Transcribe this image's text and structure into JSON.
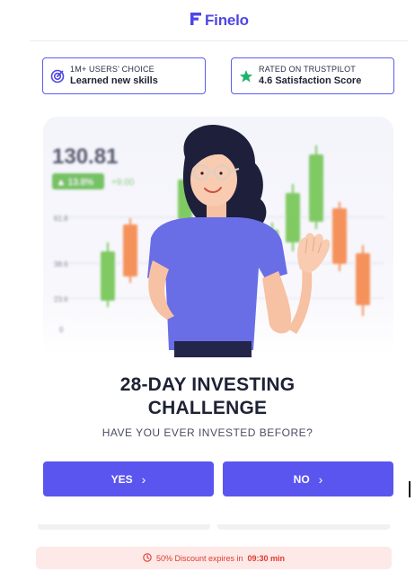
{
  "brand": {
    "name": "Finelo",
    "color": "#4f46e5"
  },
  "badges": [
    {
      "icon": "target-icon",
      "small": "1M+ USERS' CHOICE",
      "big": "Learned new skills"
    },
    {
      "icon": "star-icon",
      "small": "RATED ON TRUSTPILOT",
      "big": "4.6 Satisfaction Score"
    }
  ],
  "hero": {
    "price": "130.81",
    "change_badge": "▲ 13.8%",
    "change_abs": "+9.00",
    "axis_ticks": [
      "61.8",
      "38.6",
      "23.6",
      "0"
    ]
  },
  "question": {
    "title_line1": "28-DAY INVESTING",
    "title_line2": "CHALLENGE",
    "subtitle": "HAVE YOU EVER INVESTED BEFORE?"
  },
  "answers": [
    {
      "label": "YES",
      "icon": "chevron-right-icon"
    },
    {
      "label": "NO",
      "icon": "chevron-right-icon"
    }
  ],
  "discount": {
    "icon": "clock-icon",
    "text": "50% Discount expires in",
    "time": "09:30 min"
  },
  "colors": {
    "accent": "#5b55f0",
    "candle_green": "#6cc24a",
    "candle_orange": "#f5813f",
    "discount_bg": "#fde9e7",
    "discount_text": "#e03b2e"
  }
}
